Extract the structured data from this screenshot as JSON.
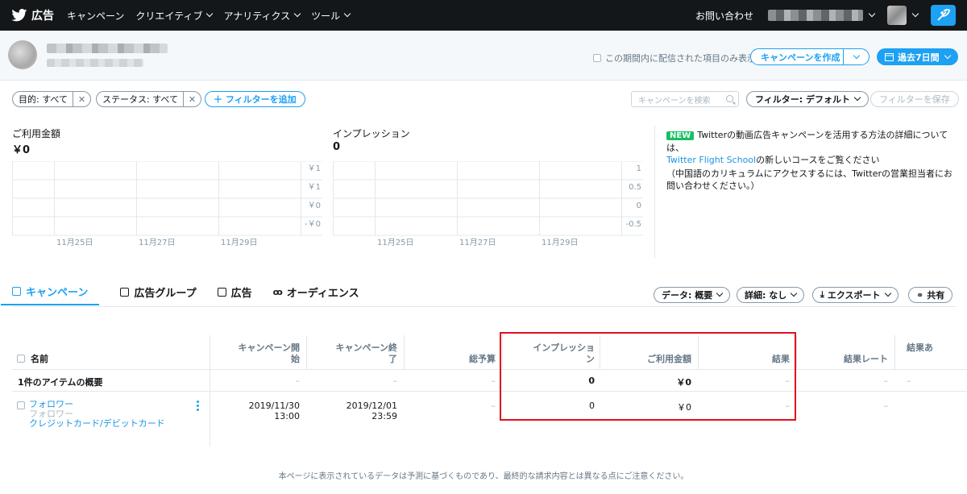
{
  "nav": {
    "brand": "広告",
    "items": [
      "キャンペーン",
      "クリエイティブ",
      "アナリティクス",
      "ツール"
    ],
    "contact": "お問い合わせ"
  },
  "header": {
    "period_checkbox_label": "この期間内に配信された項目のみ表示",
    "create_campaign": "キャンペーンを作成",
    "date_range": "過去7日間"
  },
  "filters": {
    "objective": "目的: すべて",
    "status": "ステータス: すべて",
    "add_filter": "＋ フィルターを追加",
    "search_placeholder": "キャンペーンを検索",
    "filter_default": "フィルター: デフォルト",
    "save_filter": "フィルターを保存"
  },
  "metrics": {
    "spend": {
      "label": "ご利用金額",
      "value": "￥0",
      "yticks": [
        "￥1",
        "￥1",
        "￥0",
        "-￥0"
      ]
    },
    "impressions": {
      "label": "インプレッション",
      "value": "0",
      "yticks": [
        "1",
        "0.5",
        "0",
        "-0.5"
      ]
    },
    "xticks": [
      "11月25日",
      "11月27日",
      "11月29日"
    ]
  },
  "info": {
    "badge": "NEW",
    "line1": "Twitterの動画広告キャンペーンを活用する方法の詳細については、",
    "link": "Twitter Flight School",
    "line1b": "の新しいコースをご覧ください",
    "line2": "（中国語のカリキュラムにアクセスするには、Twitterの営業担当者にお問い合わせください。）"
  },
  "tabs": [
    "キャンペーン",
    "広告グループ",
    "広告",
    "オーディエンス"
  ],
  "toolbar": {
    "data": "データ: 概要",
    "detail": "詳細: なし",
    "export": "エクスポート",
    "share": "共有"
  },
  "table": {
    "headers": {
      "name": "名前",
      "start": [
        "キャンペーン開",
        "始"
      ],
      "end": [
        "キャンペーン終",
        "了"
      ],
      "budget": "総予算",
      "impressions": [
        "インプレッショ",
        "ン"
      ],
      "spend": "ご利用金額",
      "results": "結果",
      "result_rate": "結果レート",
      "result_more": "結果あ"
    },
    "summary": {
      "label": "1件のアイテムの概要",
      "start": "–",
      "end": "–",
      "budget": "–",
      "impressions": "0",
      "spend": "￥0",
      "results": "–",
      "result_rate": "–",
      "result_more": "–"
    },
    "row": {
      "name": "フォロワー",
      "objective": "フォロワー",
      "payment": "クレジットカード/デビットカード",
      "start_date": "2019/11/30",
      "start_time": "13:00",
      "end_date": "2019/12/01",
      "end_time": "23:59",
      "budget": "–",
      "impressions": "0",
      "spend": "￥0",
      "results": "–",
      "result_rate": "–"
    }
  },
  "footer": "本ページに表示されているデータは予測に基づくものであり、最終的な請求内容とは異なる点にご注意ください。",
  "colors": {
    "accent": "#1da1f2",
    "nav_bg": "#14171a",
    "highlight": "#e0101d",
    "new_badge": "#17bf63"
  }
}
